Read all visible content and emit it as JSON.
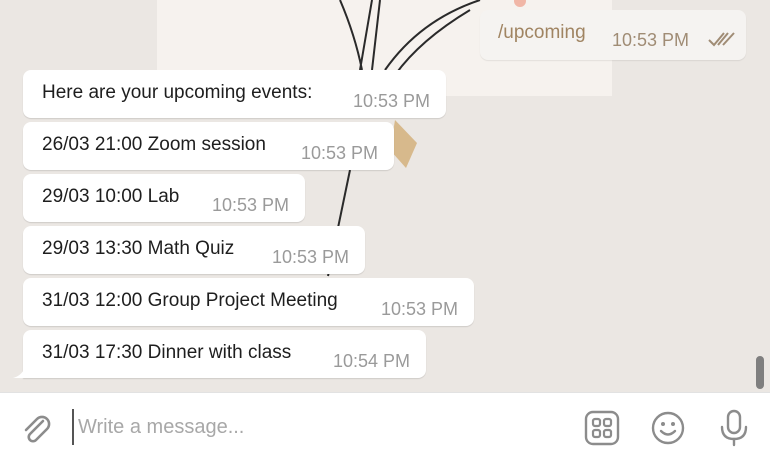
{
  "outgoing": {
    "text": "/upcoming",
    "time": "10:53 PM",
    "status_icon": "double-check-icon"
  },
  "messages": [
    {
      "text": "Here are your upcoming events:",
      "time": "10:53 PM"
    },
    {
      "text": "26/03 21:00  Zoom session",
      "time": "10:53 PM"
    },
    {
      "text": "29/03 10:00  Lab",
      "time": "10:53 PM"
    },
    {
      "text": "29/03 13:30  Math Quiz",
      "time": "10:53 PM"
    },
    {
      "text": "31/03 12:00  Group Project Meeting",
      "time": "10:53 PM"
    },
    {
      "text": "31/03 17:30  Dinner with class",
      "time": "10:54 PM"
    }
  ],
  "composer": {
    "placeholder": "Write a message...",
    "icons": [
      "paperclip-icon",
      "commands-grid-icon",
      "emoji-icon",
      "microphone-icon"
    ]
  },
  "colors": {
    "accent": "#a08462",
    "background": "#ebe7e3",
    "bubble": "#ffffff"
  }
}
